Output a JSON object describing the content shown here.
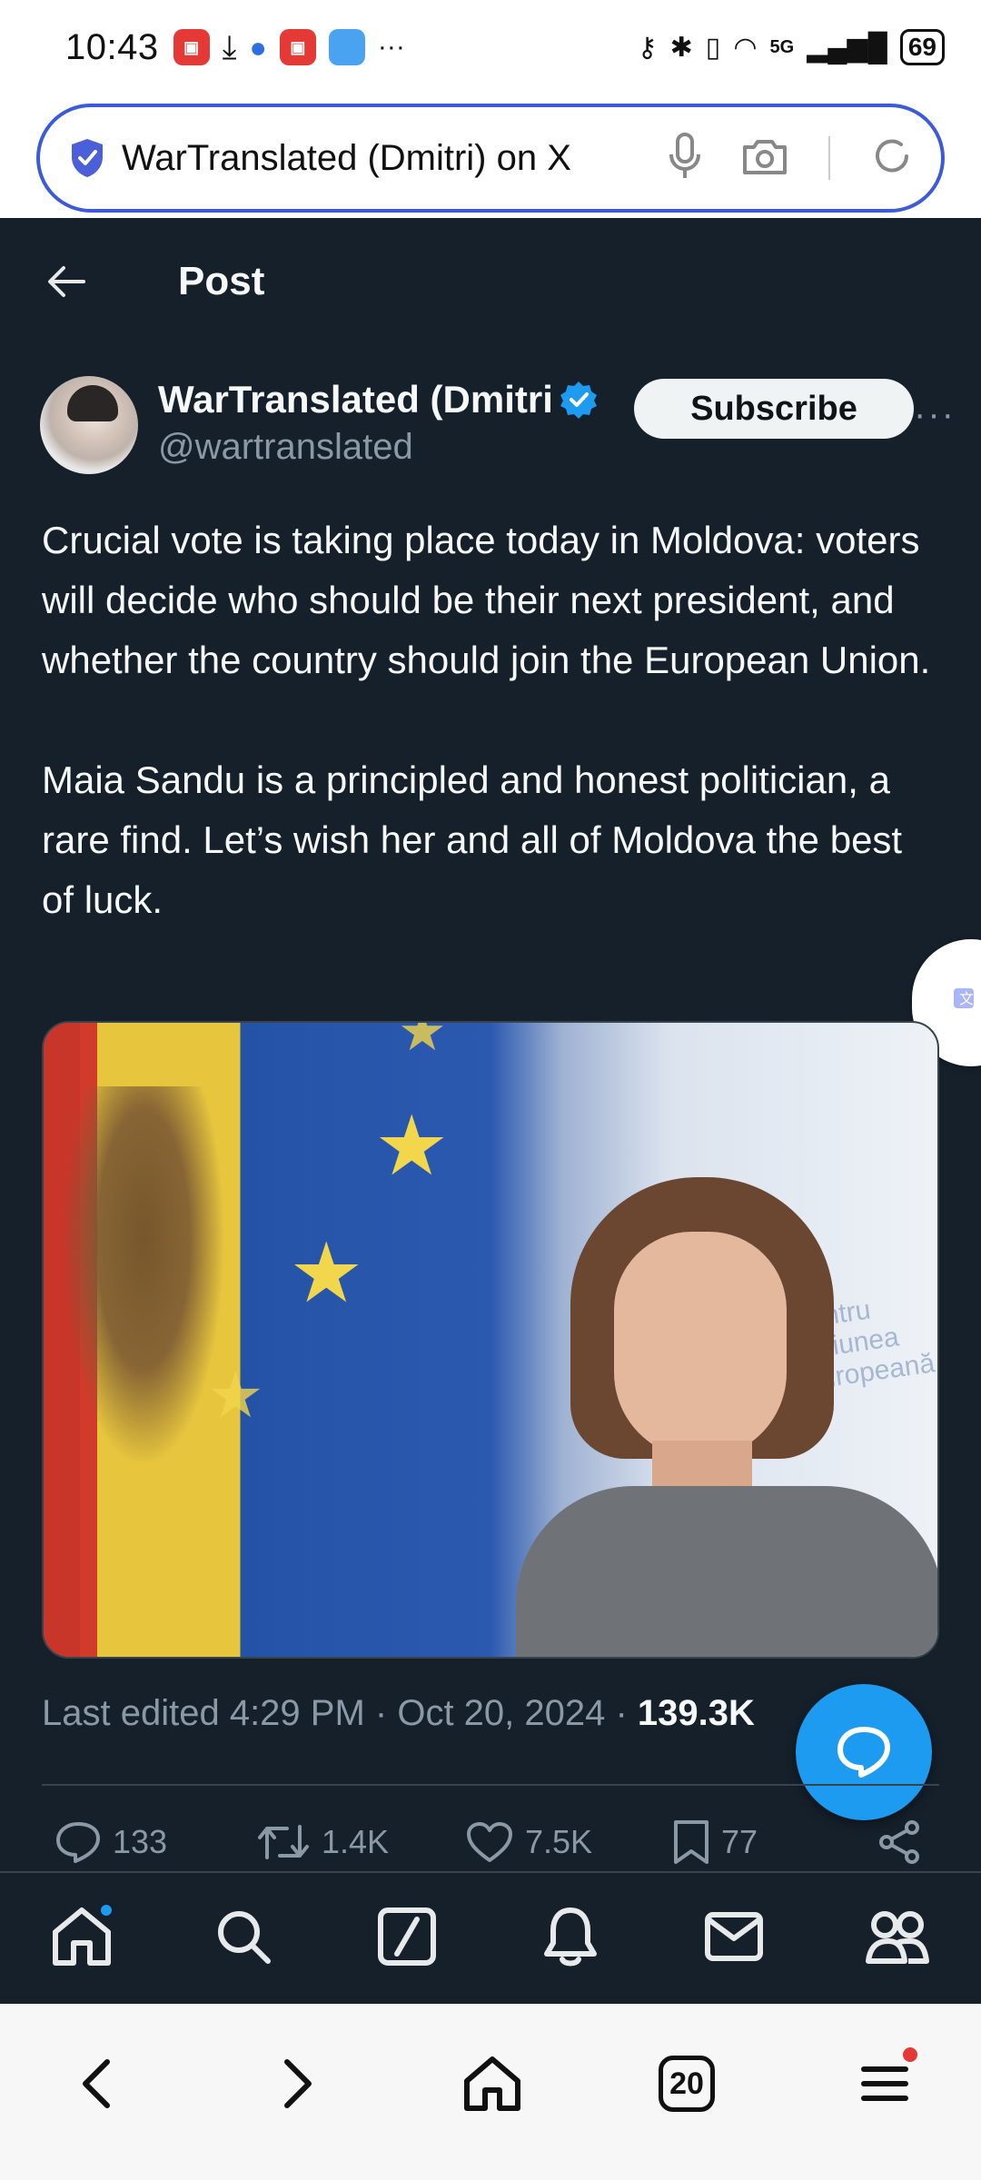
{
  "status_bar": {
    "time": "10:43",
    "more": "···",
    "network": "5G",
    "battery": "69"
  },
  "browser": {
    "url_text": "WarTranslated (Dmitri) on X",
    "tab_count": "20"
  },
  "header": {
    "title": "Post"
  },
  "author": {
    "display_name": "WarTranslated (Dmitri",
    "handle": "@wartranslated",
    "subscribe_label": "Subscribe",
    "more": "···"
  },
  "tweet": {
    "text": "Crucial vote is taking place today in Moldova: voters will decide who should be their next president, and whether the country should join the European Union.\n\nMaia Sandu is a principled and honest politician, a rare find. Let’s wish her and all of Moldova the best of luck.",
    "photo_wall_text": "pentru Uniunea Europeană"
  },
  "meta": {
    "edited": "Last edited 4:29 PM · Oct 20, 2024 · ",
    "views": "139.3K"
  },
  "actions": {
    "replies": "133",
    "reposts": "1.4K",
    "likes": "7.5K",
    "bookmarks": "77"
  },
  "colors": {
    "background": "#15202b",
    "accent": "#1d9bf0",
    "url_border": "#3b5bdb"
  }
}
